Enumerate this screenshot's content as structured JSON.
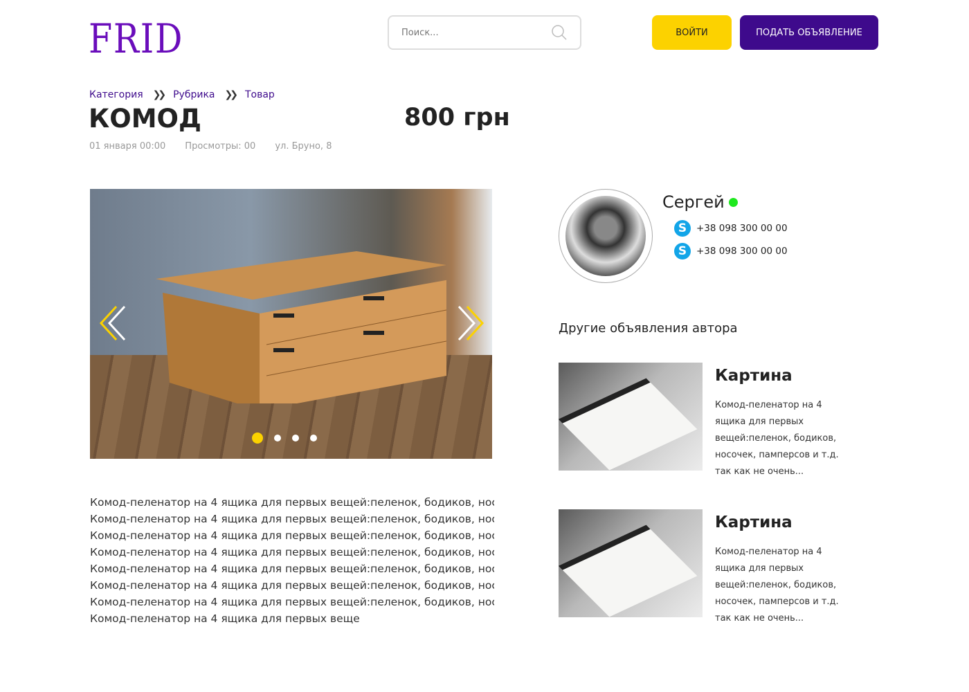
{
  "header": {
    "logo": "FRID",
    "search_placeholder": "Поиск...",
    "login_label": "ВОЙТИ",
    "post_label": "ПОДАТЬ ОБЪЯВЛЕНИЕ"
  },
  "breadcrumb": [
    "Категория",
    "Рубрика",
    "Товар"
  ],
  "listing": {
    "title": "КОМОД",
    "price": "800 грн",
    "date": "01 января 00:00",
    "views": "Просмотры: 00",
    "address": "ул. Бруно, 8"
  },
  "gallery": {
    "slides": 4,
    "active_slide": 1,
    "accent": "#fcd200"
  },
  "description": [
    "Комод-пеленатор на 4 ящика для первых вещей:пеленок, бодиков, носочек, пам",
    "Комод-пеленатор на 4 ящика для первых вещей:пеленок, бодиков, носочек, пам",
    "Комод-пеленатор на 4 ящика для первых вещей:пеленок, бодиков, носочек, пам",
    "Комод-пеленатор на 4 ящика для первых вещей:пеленок, бодиков, носочек, пам",
    "Комод-пеленатор на 4 ящика для первых вещей:пеленок, бодиков, носочек, пам",
    "Комод-пеленатор на 4 ящика для первых вещей:пеленок, бодиков, носочек, пам",
    "Комод-пеленатор на 4 ящика для первых вещей:пеленок, бодиков, носочек, пам",
    "Комод-пеленатор на 4 ящика для первых веще"
  ],
  "seller": {
    "name": "Сергей",
    "online": true,
    "phones": [
      "+38 098 300 00 00",
      "+38 098 300 00 00"
    ]
  },
  "other_ads": {
    "heading": "Другие объявления автора",
    "items": [
      {
        "title": "Картина",
        "text": "Комод-пеленатор на 4 ящика для первых вещей:пеленок, бодиков, носочек, памперсов и т.д. так как не очень..."
      },
      {
        "title": "Картина",
        "text": "Комод-пеленатор на 4 ящика для первых вещей:пеленок, бодиков, носочек, памперсов и т.д. так как не очень..."
      }
    ]
  },
  "colors": {
    "brand": "#6a0dbb",
    "primary_button": "#3e0a8c",
    "accent": "#fcd200",
    "online": "#1ee81e",
    "skype": "#12a5e8"
  }
}
